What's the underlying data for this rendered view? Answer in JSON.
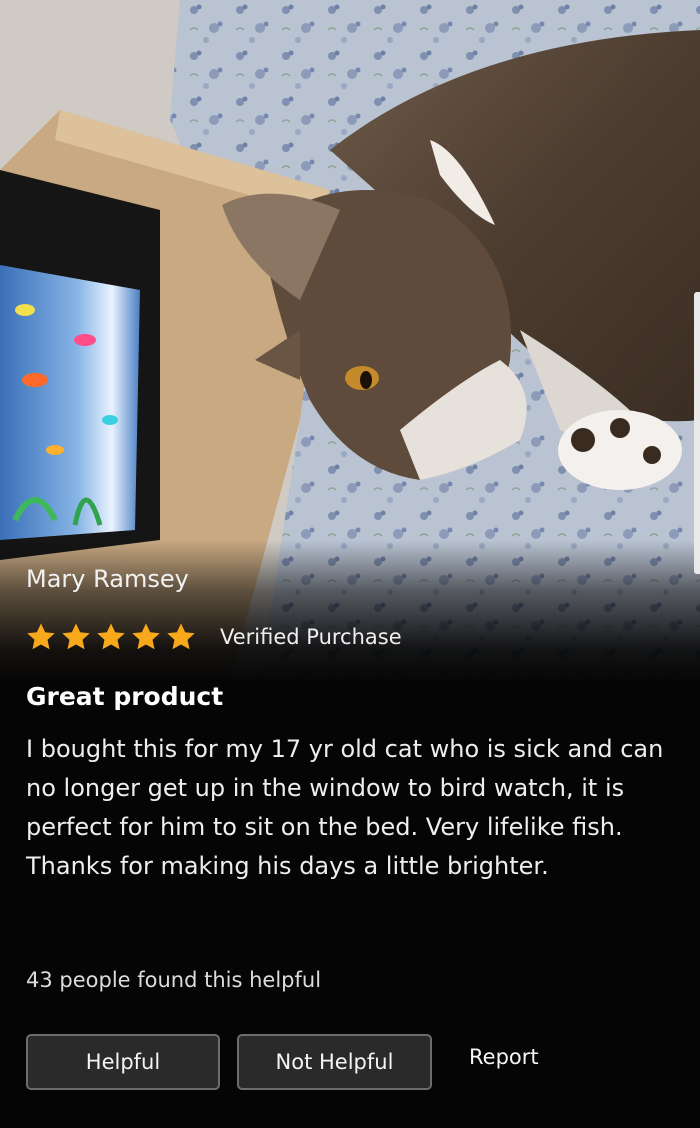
{
  "photo": {
    "description_icon": "product-photo-cat-aquarium"
  },
  "review": {
    "reviewer_name": "Mary Ramsey",
    "rating": 5,
    "rating_max": 5,
    "star_color": "#f7a81b",
    "verified_label": "Verified Purchase",
    "title": "Great product",
    "body": "I bought this for my 17 yr old cat who is sick and can no longer get up in the window to bird watch, it is perfect for him to sit on the bed. Very lifelike fish. Thanks for making his days a little brighter.",
    "helpful_count_text": "43 people found this helpful"
  },
  "actions": {
    "helpful_label": "Helpful",
    "not_helpful_label": "Not Helpful",
    "report_label": "Report"
  }
}
